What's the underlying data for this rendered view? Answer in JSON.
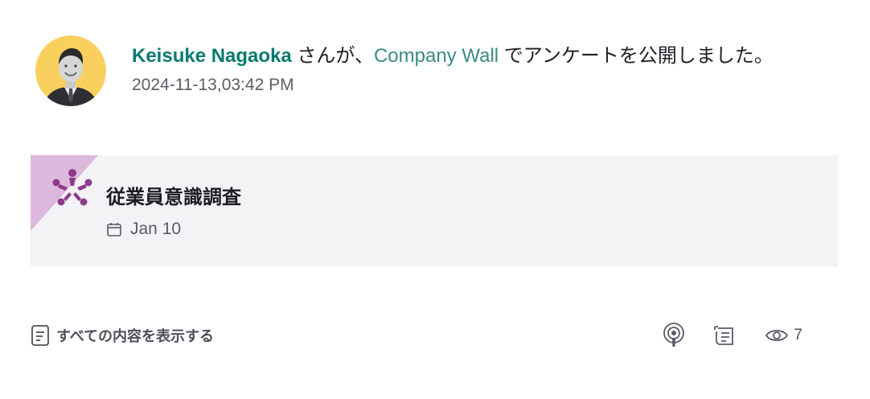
{
  "post": {
    "author": "Keisuke Nagaoka",
    "honorific": " さんが、",
    "location": "Company Wall",
    "action_text": " でアンケートを公開しました。",
    "timestamp": "2024-11-13,03:42 PM"
  },
  "survey_card": {
    "icon": "team-people-icon",
    "title": "従業員意識調査",
    "date_icon": "calendar-icon",
    "date": "Jan 10",
    "corner_color": "#dcb8dc",
    "icon_color": "#8e3a8a"
  },
  "footer": {
    "show_all_icon": "document-icon",
    "show_all_label": "すべての内容を表示する",
    "actions": [
      {
        "icon": "podcast-icon"
      },
      {
        "icon": "newspaper-icon"
      },
      {
        "icon": "eye-icon",
        "count": "7"
      }
    ]
  },
  "colors": {
    "author_link": "#087a6e",
    "wall_link": "#3a8b82",
    "avatar_bg": "#f9cf5e"
  }
}
